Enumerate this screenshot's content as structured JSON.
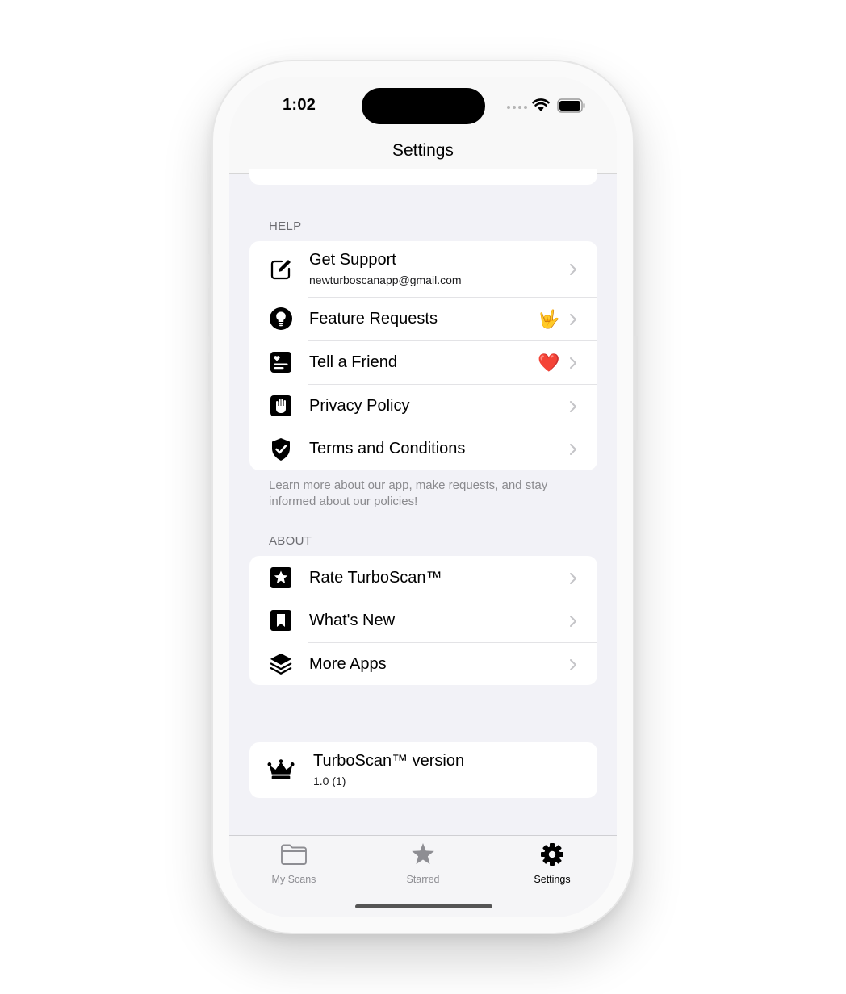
{
  "status_bar": {
    "time": "1:02"
  },
  "nav": {
    "title": "Settings"
  },
  "help_section": {
    "header": "HELP",
    "items": [
      {
        "label": "Get Support",
        "subtitle": "newturboscanapp@gmail.com",
        "icon": "compose-icon"
      },
      {
        "label": "Feature Requests",
        "icon": "lightbulb-icon",
        "accessory": "🤟"
      },
      {
        "label": "Tell a Friend",
        "icon": "contact-card-icon",
        "accessory": "❤️"
      },
      {
        "label": "Privacy Policy",
        "icon": "hand-raised-icon"
      },
      {
        "label": "Terms and Conditions",
        "icon": "checkmark-shield-icon"
      }
    ],
    "footer": "Learn more about our app, make requests, and stay informed about our policies!"
  },
  "about_section": {
    "header": "ABOUT",
    "items": [
      {
        "label": "Rate TurboScan™",
        "icon": "star-square-icon"
      },
      {
        "label": "What's New",
        "icon": "bookmark-square-icon"
      },
      {
        "label": "More Apps",
        "icon": "stack-layers-icon"
      }
    ]
  },
  "version": {
    "title": "TurboScan™ version",
    "value": "1.0 (1)",
    "icon": "crown-icon"
  },
  "tab_bar": {
    "tabs": [
      {
        "label": "My Scans",
        "icon": "folder-icon",
        "active": false
      },
      {
        "label": "Starred",
        "icon": "star-icon",
        "active": false
      },
      {
        "label": "Settings",
        "icon": "gear-icon",
        "active": true
      }
    ]
  },
  "colors": {
    "background": "#f2f2f7",
    "card": "#ffffff",
    "secondary_text": "#6d6d72",
    "inactive_tab": "#8e8e93",
    "chevron": "#c4c4c7"
  }
}
